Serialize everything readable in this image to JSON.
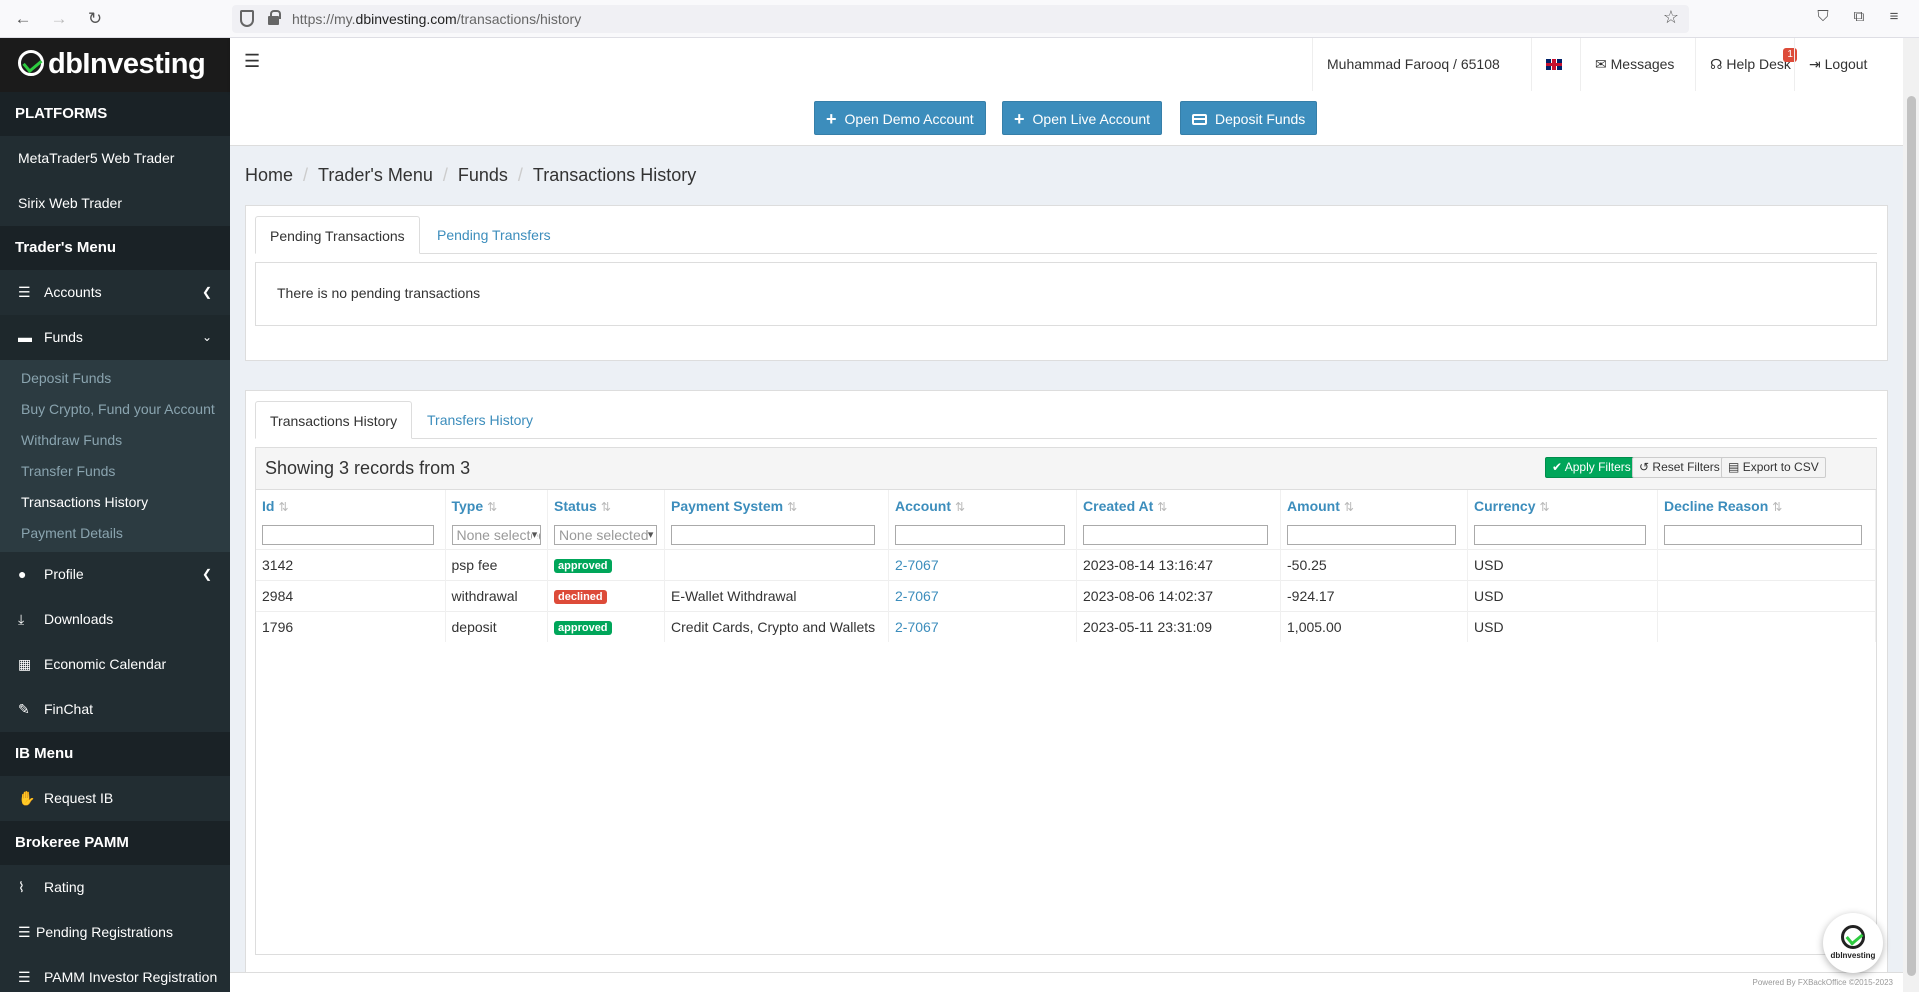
{
  "browser": {
    "url_prefix": "https://my.",
    "url_domain": "dbinvesting.com",
    "url_path": "/transactions/history"
  },
  "sidebar": {
    "logo": "dbInvesting",
    "sections": {
      "platforms": "PLATFORMS",
      "traders_menu": "Trader's Menu",
      "ib_menu": "IB Menu",
      "brokeree_pamm": "Brokeree PAMM"
    },
    "platform_items": [
      "MetaTrader5 Web Trader",
      "Sirix Web Trader"
    ],
    "accounts": "Accounts",
    "funds": "Funds",
    "funds_sub": [
      "Deposit Funds",
      "Buy Crypto, Fund your Account",
      "Withdraw Funds",
      "Transfer Funds",
      "Transactions History",
      "Payment Details"
    ],
    "profile": "Profile",
    "downloads": "Downloads",
    "economic_calendar": "Economic Calendar",
    "finchat": "FinChat",
    "request_ib": "Request IB",
    "rating": "Rating",
    "pending_registrations": "Pending Registrations",
    "pamm_investor_registration": "PAMM Investor Registration"
  },
  "topbar": {
    "user": "Muhammad Farooq / 65108",
    "messages": "Messages",
    "help_desk": "Help Desk",
    "help_badge": "1",
    "logout": "Logout"
  },
  "actions": {
    "open_demo": "Open Demo Account",
    "open_live": "Open Live Account",
    "deposit": "Deposit Funds"
  },
  "breadcrumb": [
    "Home",
    "Trader's Menu",
    "Funds",
    "Transactions History"
  ],
  "pending": {
    "tabs": [
      "Pending Transactions",
      "Pending Transfers"
    ],
    "empty_message": "There is no pending transactions"
  },
  "history": {
    "tabs": [
      "Transactions History",
      "Transfers History"
    ],
    "showing": "Showing 3 records from 3",
    "apply_filters": "Apply Filters",
    "reset_filters": "Reset Filters",
    "export_csv": "Export to CSV",
    "columns": [
      "Id",
      "Type",
      "Status",
      "Payment System",
      "Account",
      "Created At",
      "Amount",
      "Currency",
      "Decline Reason"
    ],
    "select_placeholder": "None selected",
    "rows": [
      {
        "id": "3142",
        "type": "psp fee",
        "status": "approved",
        "payment_system": "",
        "account": "2-7067",
        "created_at": "2023-08-14 13:16:47",
        "amount": "-50.25",
        "currency": "USD",
        "decline_reason": ""
      },
      {
        "id": "2984",
        "type": "withdrawal",
        "status": "declined",
        "payment_system": "E-Wallet Withdrawal",
        "account": "2-7067",
        "created_at": "2023-08-06 14:02:37",
        "amount": "-924.17",
        "currency": "USD",
        "decline_reason": ""
      },
      {
        "id": "1796",
        "type": "deposit",
        "status": "approved",
        "payment_system": "Credit Cards, Crypto and Wallets",
        "account": "2-7067",
        "created_at": "2023-05-11 23:31:09",
        "amount": "1,005.00",
        "currency": "USD",
        "decline_reason": ""
      }
    ]
  },
  "footer": "Powered By FXBackOffice ©2015-2023",
  "chat_widget": "dbInvesting",
  "colors": {
    "primary": "#3c8dbc",
    "success": "#00a65a",
    "danger": "#dd4b39",
    "sidebar": "#222d32"
  }
}
